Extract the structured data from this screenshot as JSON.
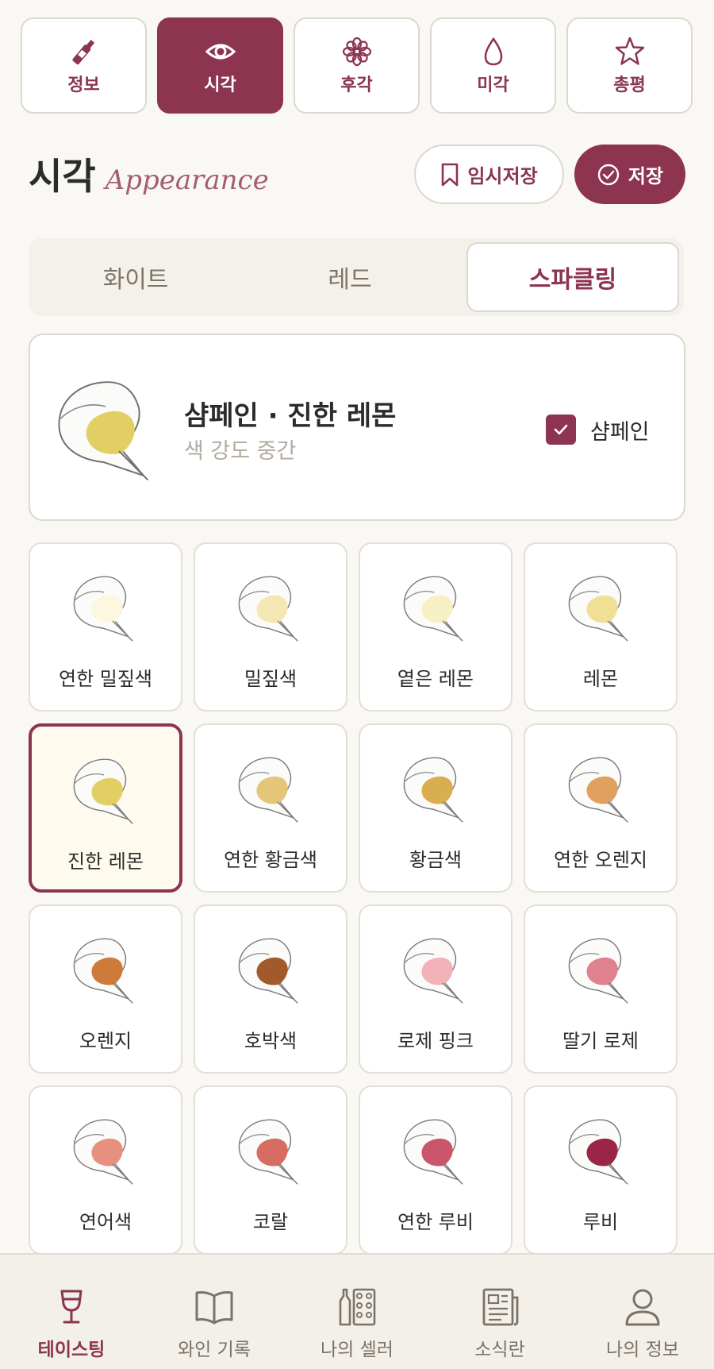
{
  "top_tabs": [
    {
      "label": "정보",
      "icon": "wine-bottle-icon"
    },
    {
      "label": "시각",
      "icon": "eye-icon"
    },
    {
      "label": "후각",
      "icon": "flower-icon"
    },
    {
      "label": "미각",
      "icon": "drop-icon"
    },
    {
      "label": "총평",
      "icon": "star-icon"
    }
  ],
  "active_tab": "시각",
  "section": {
    "title_ko": "시각",
    "title_en": "Appearance"
  },
  "buttons": {
    "draft": "임시저장",
    "save": "저장"
  },
  "wine_types": [
    "화이트",
    "레드",
    "스파클링"
  ],
  "active_wine_type": "스파클링",
  "selected": {
    "name": "샴페인 · 진한 레몬",
    "sub": "색 강도 중간",
    "checkbox_label": "샴페인",
    "checked": true,
    "color": "#e2cf63"
  },
  "colors": [
    {
      "label": "연한 밀짚색",
      "color": "#fdf7df"
    },
    {
      "label": "밀짚색",
      "color": "#f5e7b4"
    },
    {
      "label": "옅은 레몬",
      "color": "#f7f0c4"
    },
    {
      "label": "레몬",
      "color": "#efe095"
    },
    {
      "label": "진한 레몬",
      "color": "#e2cf63"
    },
    {
      "label": "연한 황금색",
      "color": "#e3c677"
    },
    {
      "label": "황금색",
      "color": "#d8ae4f"
    },
    {
      "label": "연한 오렌지",
      "color": "#e0a060"
    },
    {
      "label": "오렌지",
      "color": "#cc7b3a"
    },
    {
      "label": "호박색",
      "color": "#a35a2a"
    },
    {
      "label": "로제 핑크",
      "color": "#f3b2b8"
    },
    {
      "label": "딸기 로제",
      "color": "#e0828e"
    },
    {
      "label": "연어색",
      "color": "#e69180"
    },
    {
      "label": "코랄",
      "color": "#d76c62"
    },
    {
      "label": "연한 루비",
      "color": "#c9566b"
    },
    {
      "label": "루비",
      "color": "#9a2547"
    }
  ],
  "selected_color": "진한 레몬",
  "bottom_nav": [
    {
      "label": "테이스팅",
      "icon": "wine-glass-icon"
    },
    {
      "label": "와인 기록",
      "icon": "book-icon"
    },
    {
      "label": "나의 셀러",
      "icon": "cellar-icon"
    },
    {
      "label": "소식란",
      "icon": "newspaper-icon"
    },
    {
      "label": "나의 정보",
      "icon": "user-icon"
    }
  ],
  "active_nav": "테이스팅",
  "theme": {
    "accent": "#8c3450",
    "bg": "#faf8f4"
  }
}
